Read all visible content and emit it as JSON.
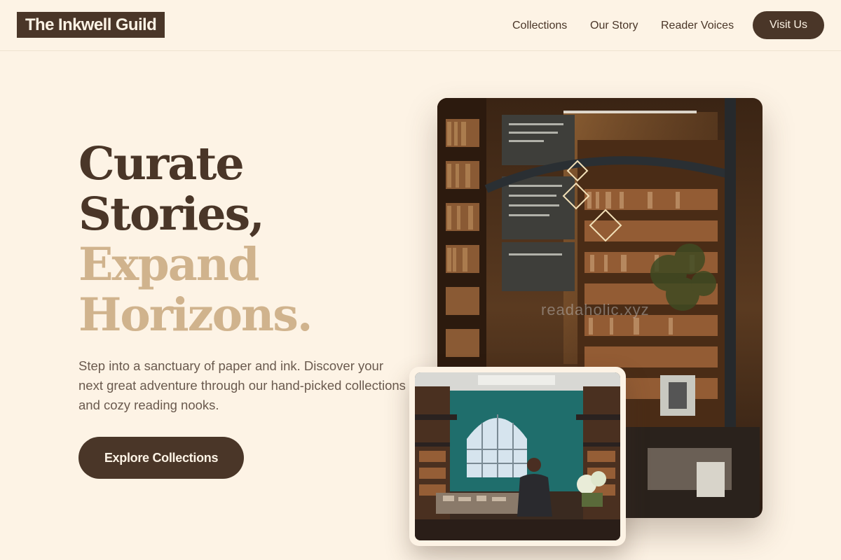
{
  "header": {
    "logo": "The Inkwell Guild",
    "nav": [
      "Collections",
      "Our Story",
      "Reader Voices"
    ],
    "cta": "Visit Us"
  },
  "hero": {
    "headline": [
      "Curate",
      "Stories,",
      "Expand",
      "Horizons."
    ],
    "description": "Step into a sanctuary of paper and ink. Discover your next great adventure through our hand-picked collections and cozy reading nooks.",
    "button": "Explore Collections"
  },
  "images": {
    "main_watermark": "readaholic.xyz",
    "main_alt": "bookstore-interior-photo",
    "inset_alt": "library-hall-photo"
  },
  "colors": {
    "background": "#fdf3e5",
    "primary_brown": "#4a3628",
    "accent_tan": "#d0b38d",
    "body_text": "#6a5a4e"
  }
}
